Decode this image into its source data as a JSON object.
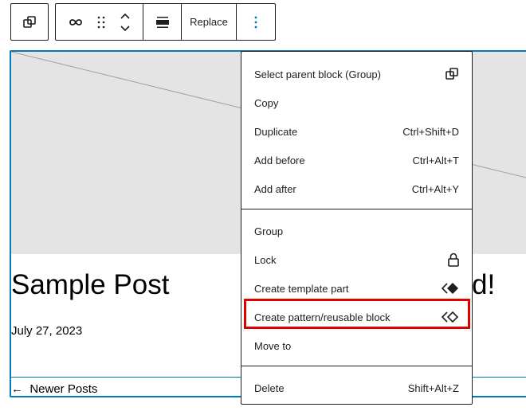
{
  "toolbar": {
    "parent_icon": "select-parent-icon",
    "link_icon": "link-icon",
    "drag_icon": "drag-handle-icon",
    "move_icon": "move-up-down-icon",
    "align_icon": "align-center-icon",
    "replace_label": "Replace",
    "options_icon": "more-vertical-icon"
  },
  "post": {
    "title": "Sample Post",
    "title_tail": "d!",
    "date": "July 27, 2023",
    "newer": "←  Newer Posts"
  },
  "menu": {
    "items": [
      {
        "label": "Select parent block (Group)",
        "icon": "select-parent-icon"
      },
      {
        "label": "Copy"
      },
      {
        "label": "Duplicate",
        "shortcut": "Ctrl+Shift+D"
      },
      {
        "label": "Add before",
        "shortcut": "Ctrl+Alt+T"
      },
      {
        "label": "Add after",
        "shortcut": "Ctrl+Alt+Y"
      },
      {
        "label": "Group"
      },
      {
        "label": "Lock",
        "icon": "lock-icon"
      },
      {
        "label": "Create template part",
        "icon": "template-part-icon"
      },
      {
        "label": "Create pattern/reusable block",
        "icon": "reusable-block-icon"
      },
      {
        "label": "Move to"
      },
      {
        "label": "Delete",
        "shortcut": "Shift+Alt+Z"
      }
    ],
    "highlight_color": "#e00000"
  },
  "colors": {
    "accent": "#007cba",
    "options_icon": "#007cba"
  }
}
